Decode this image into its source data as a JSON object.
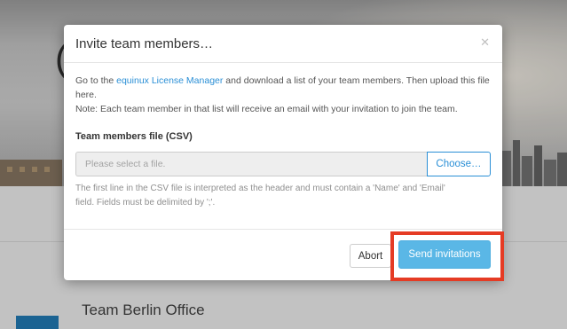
{
  "background": {
    "hero_letter": "(",
    "section_title": "Team Berlin Office"
  },
  "modal": {
    "title": "Invite team members…",
    "close_icon": "close-icon",
    "intro": {
      "before_link": "Go to the ",
      "link_text": "equinux License Manager",
      "after_link": " and download a list of your team members. Then upload this file here.",
      "note": "Note: Each team member in that list will receive an email with your invitation to join the team."
    },
    "field_label": "Team members file (CSV)",
    "file_input": {
      "placeholder": "Please select a file.",
      "value": ""
    },
    "choose_label": "Choose…",
    "help": {
      "line1": "The first line in the CSV file is interpreted as the header and must contain a 'Name' and 'Email'",
      "line2": "field. Fields must be delimited by ';'."
    },
    "footer": {
      "abort_label": "Abort",
      "send_label": "Send invitations"
    }
  },
  "colors": {
    "link": "#2a8fd6",
    "primary_button": "#5ab7e6",
    "highlight": "#e53b24",
    "side_tab": "#1f6fa3"
  }
}
